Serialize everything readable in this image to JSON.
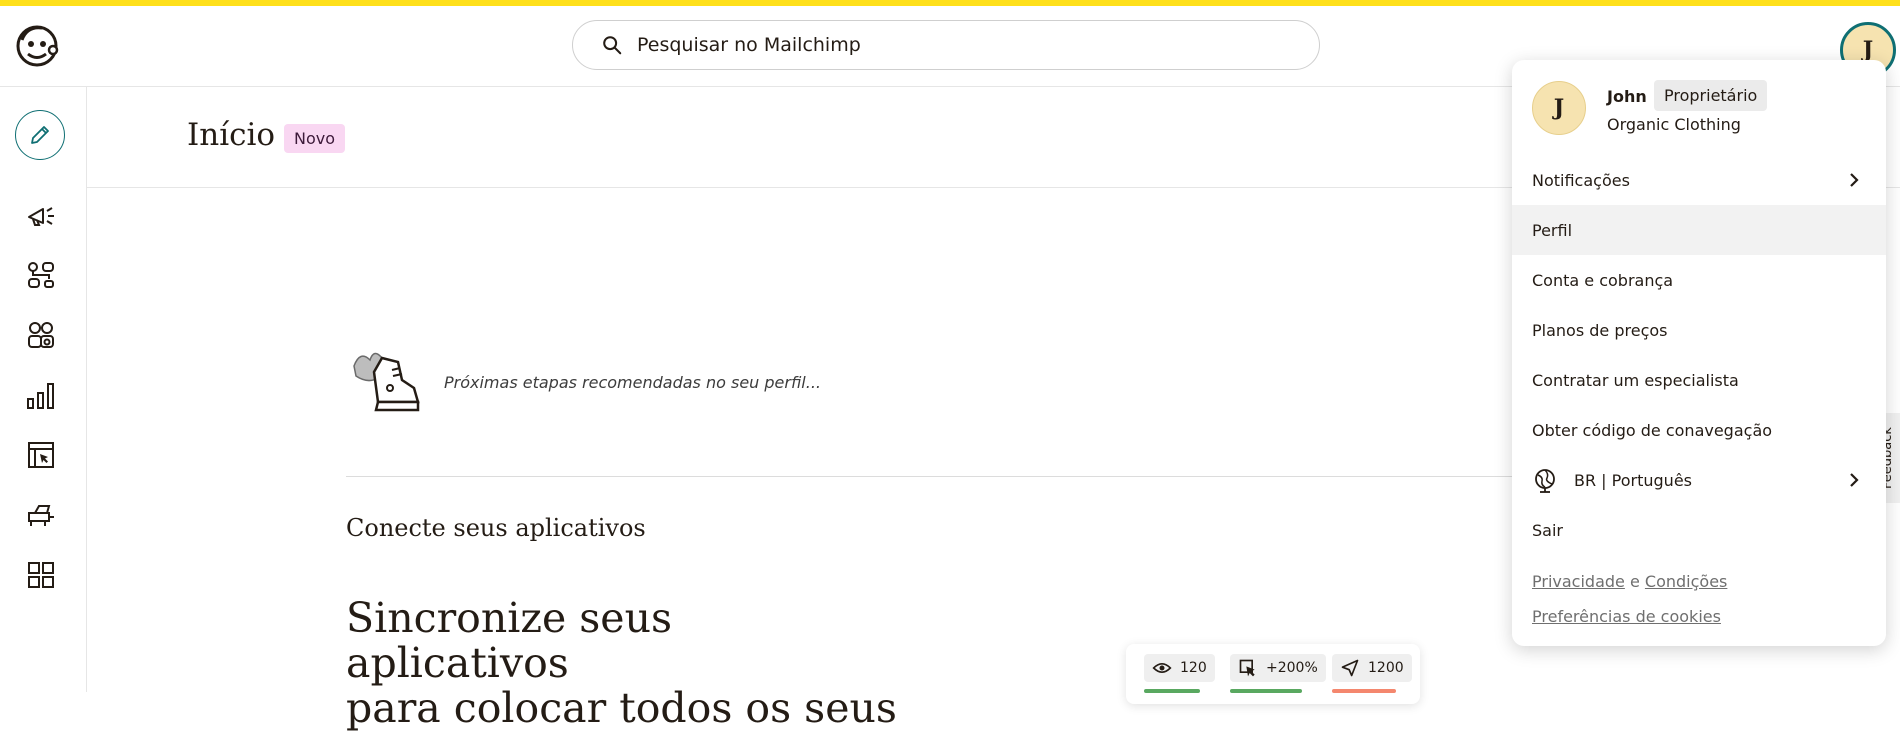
{
  "app": {
    "search_placeholder": "Pesquisar no Mailchimp",
    "avatar_initial": "J",
    "accent_color": "#ffe01b",
    "teal_color": "#0f6f73"
  },
  "sidebar": {
    "items": [
      {
        "icon": "pencil-icon",
        "label": "create"
      },
      {
        "icon": "megaphone-icon"
      },
      {
        "icon": "automation-icon"
      },
      {
        "icon": "audience-icon"
      },
      {
        "icon": "analytics-icon"
      },
      {
        "icon": "website-icon"
      },
      {
        "icon": "integrations-icon"
      },
      {
        "icon": "grid-icon"
      }
    ]
  },
  "page": {
    "title": "Início",
    "badge": "Novo",
    "next_steps": "Próximas etapas recomendadas no seu perfil...",
    "section_title": "Conecte seus aplicativos",
    "heading_line1": "Sincronize seus aplicativos",
    "heading_line2": "para colocar todos os seus"
  },
  "stats": {
    "views": "120",
    "clicks": "+200%",
    "sent": "1200"
  },
  "feedback_label": "Feedback",
  "account_menu": {
    "initial": "J",
    "name": "John",
    "role": "Proprietário",
    "org": "Organic Clothing",
    "items": {
      "notifications": "Notificações",
      "profile": "Perfil",
      "billing": "Conta e cobrança",
      "plans": "Planos de preços",
      "expert": "Contratar um especialista",
      "conavigation": "Obter código de conavegação",
      "language": "BR | Português",
      "logout": "Sair"
    },
    "footer": {
      "privacy": "Privacidade",
      "and": "e",
      "terms": "Condições",
      "cookies": "Preferências de cookies"
    }
  }
}
